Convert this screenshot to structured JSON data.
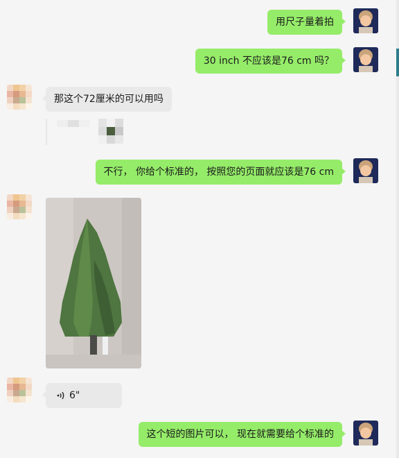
{
  "messages": [
    {
      "side": "right",
      "type": "text",
      "text": "用尺子量着拍"
    },
    {
      "side": "right",
      "type": "text",
      "text": "30 inch 不应该是76 cm 吗？"
    },
    {
      "side": "left",
      "type": "text",
      "text": "那这个72厘米的可以用吗"
    },
    {
      "side": "right",
      "type": "text",
      "text": "不行，  你给个标准的，  按照您的页面就应该是76 cm"
    },
    {
      "side": "left",
      "type": "image",
      "content": "pixelated photo of a small evergreen tree"
    },
    {
      "side": "left",
      "type": "voice",
      "duration": "6\""
    },
    {
      "side": "right",
      "type": "text",
      "text": "这个短的图片可以，  现在就需要给个标准的"
    }
  ],
  "icons": {
    "voice": "voice-wave-icon",
    "avatar_self": "avatar-photo-icon",
    "avatar_other": "pixelated-avatar-icon"
  },
  "colors": {
    "mine_bubble": "#95ec69",
    "theirs_bubble": "#e9e9ea",
    "background": "#f5f5f5"
  }
}
